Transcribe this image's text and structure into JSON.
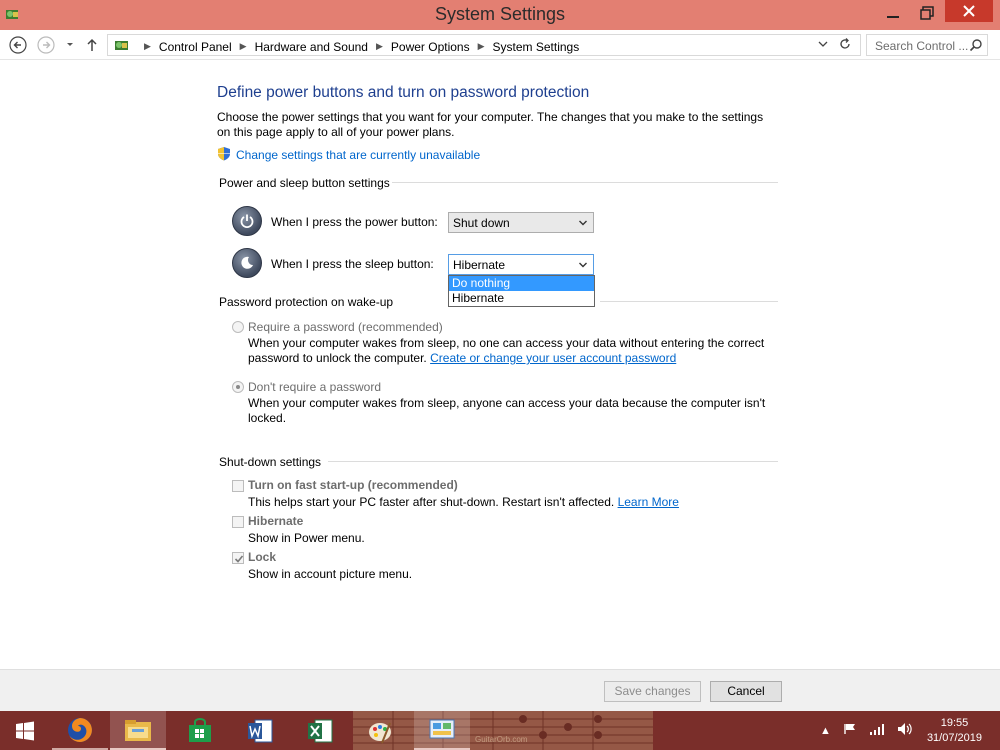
{
  "window": {
    "title": "System Settings"
  },
  "address_bar": {
    "crumbs": [
      "Control Panel",
      "Hardware and Sound",
      "Power Options",
      "System Settings"
    ],
    "search_placeholder": "Search Control ..."
  },
  "page": {
    "heading": "Define power buttons and turn on password protection",
    "intro": "Choose the power settings that you want for your computer. The changes that you make to the settings on this page apply to all of your power plans.",
    "change_link": "Change settings that are currently unavailable"
  },
  "power_sleep": {
    "title": "Power and sleep button settings",
    "power_label": "When I press the power button:",
    "power_value": "Shut down",
    "sleep_label": "When I press the sleep button:",
    "sleep_value": "Hibernate",
    "sleep_options": [
      "Do nothing",
      "Hibernate"
    ],
    "sleep_highlighted": "Do nothing"
  },
  "password": {
    "title": "Password protection on wake-up",
    "require_label": "Require a password (recommended)",
    "require_desc": "When your computer wakes from sleep, no one can access your data without entering the correct password to unlock the computer.",
    "require_link": "Create or change your user account password",
    "norequire_label": "Don't require a password",
    "norequire_desc": "When your computer wakes from sleep, anyone can access your data because the computer isn't locked.",
    "selected": "Don't require a password"
  },
  "shutdown": {
    "title": "Shut-down settings",
    "fast_label": "Turn on fast start-up (recommended)",
    "fast_desc": "This helps start your PC faster after shut-down. Restart isn't affected.",
    "fast_link": "Learn More",
    "fast_checked": false,
    "hibernate_label": "Hibernate",
    "hibernate_desc": "Show in Power menu.",
    "hibernate_checked": false,
    "lock_label": "Lock",
    "lock_desc": "Show in account picture menu.",
    "lock_checked": true
  },
  "footer": {
    "save_label": "Save changes",
    "cancel_label": "Cancel"
  },
  "taskbar": {
    "items": [
      "start-icon",
      "firefox-icon",
      "file-explorer-icon",
      "store-icon",
      "word-icon",
      "excel-icon",
      "paint-icon",
      "control-panel-icon"
    ],
    "watermark_text": "GuitarOrb.com",
    "time": "19:55",
    "date": "31/07/2019"
  },
  "colors": {
    "titlebar": "#e37f72",
    "close": "#c7392b",
    "heading": "#1e3f8f",
    "link": "#0066cc",
    "taskbar": "#7a2e2a",
    "dropdown_highlight": "#3399ff"
  }
}
